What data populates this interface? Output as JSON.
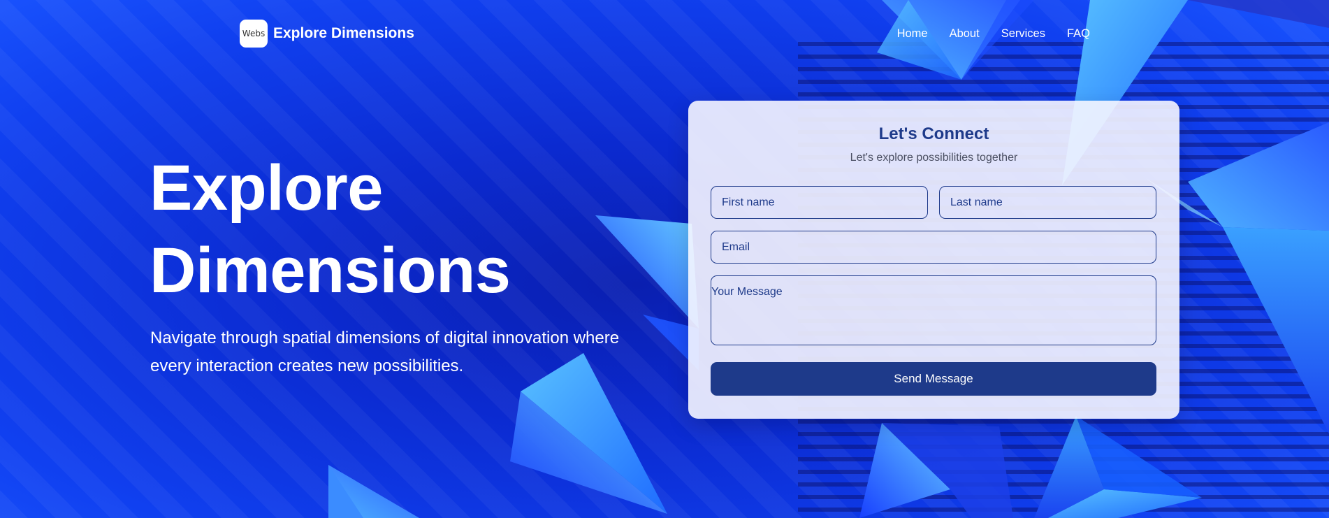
{
  "header": {
    "logo_alt": "Webs",
    "brand": "Explore Dimensions",
    "nav": [
      "Home",
      "About",
      "Services",
      "FAQ"
    ]
  },
  "hero": {
    "title_line1": "Explore",
    "title_line2": "Dimensions",
    "subtitle_line1": "Navigate through spatial dimensions of digital innovation where",
    "subtitle_line2": "every interaction creates new possibilities."
  },
  "contact": {
    "title": "Let's Connect",
    "subtitle": "Let's explore possibilities together",
    "first_name_placeholder": "First name",
    "last_name_placeholder": "Last name",
    "email_placeholder": "Email",
    "message_placeholder": "Your Message",
    "send_label": "Send Message"
  },
  "colors": {
    "background": "#0a2fd6",
    "accent": "#1e3a8a",
    "card": "#f6f6ff",
    "text_light": "#ffffff"
  }
}
